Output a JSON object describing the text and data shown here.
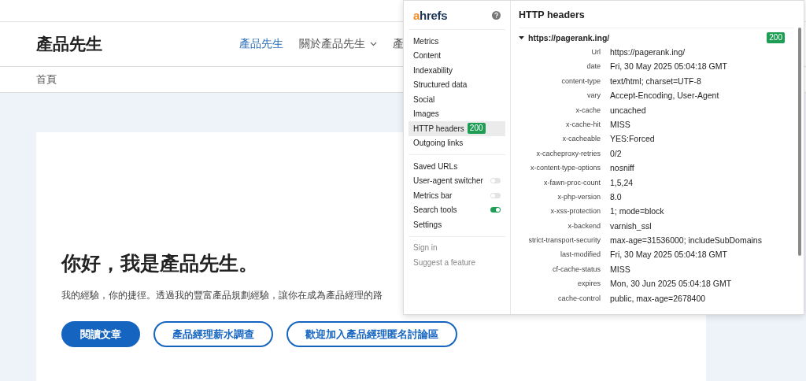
{
  "site": {
    "logo": "產品先生",
    "nav": [
      {
        "label": "產品先生",
        "selected": true
      },
      {
        "label": "關於產品先生",
        "selected": false,
        "dropdown": true
      },
      {
        "label": "產",
        "selected": false
      }
    ],
    "breadcrumb": "首頁",
    "hero": {
      "heading": "你好，我是產品先生。",
      "text": "我的經驗，你的捷徑。透過我的豐富產品規劃經驗，讓你在成為產品經理的路",
      "buttons": [
        {
          "label": "閱讀文章",
          "kind": "primary"
        },
        {
          "label": "產品經理薪水調查",
          "kind": "outline"
        },
        {
          "label": "歡迎加入產品經理匿名討論區",
          "kind": "outline"
        }
      ]
    }
  },
  "extension": {
    "logo": "ahrefs",
    "menu_sections": [
      [
        {
          "label": "Metrics",
          "kind": "link",
          "selected": false
        },
        {
          "label": "Content",
          "kind": "link",
          "selected": false
        },
        {
          "label": "Indexability",
          "kind": "link",
          "selected": false
        },
        {
          "label": "Structured data",
          "kind": "link",
          "selected": false
        },
        {
          "label": "Social",
          "kind": "link",
          "selected": false
        },
        {
          "label": "Images",
          "kind": "link",
          "selected": false
        },
        {
          "label": "HTTP headers",
          "kind": "link",
          "selected": true,
          "badge": "200"
        },
        {
          "label": "Outgoing links",
          "kind": "link",
          "selected": false
        }
      ],
      [
        {
          "label": "Saved URLs",
          "kind": "link",
          "selected": false
        },
        {
          "label": "User-agent switcher",
          "kind": "toggle",
          "selected": false,
          "on": false
        },
        {
          "label": "Metrics bar",
          "kind": "toggle",
          "selected": false,
          "on": false
        },
        {
          "label": "Search tools",
          "kind": "toggle",
          "selected": false,
          "on": true
        },
        {
          "label": "Settings",
          "kind": "link",
          "selected": false
        }
      ],
      [
        {
          "label": "Sign in",
          "kind": "muted",
          "selected": false
        },
        {
          "label": "Suggest a feature",
          "kind": "muted",
          "selected": false
        }
      ]
    ],
    "panel": {
      "title": "HTTP headers",
      "url": "https://pagerank.ing/",
      "expanded": true,
      "status": "200",
      "headers": [
        {
          "name": "Url",
          "value": "https://pagerank.ing/"
        },
        {
          "name": "date",
          "value": "Fri, 30 May 2025 05:04:18 GMT"
        },
        {
          "name": "content-type",
          "value": "text/html; charset=UTF-8"
        },
        {
          "name": "vary",
          "value": "Accept-Encoding, User-Agent"
        },
        {
          "name": "x-cache",
          "value": "uncached"
        },
        {
          "name": "x-cache-hit",
          "value": "MISS"
        },
        {
          "name": "x-cacheable",
          "value": "YES:Forced"
        },
        {
          "name": "x-cacheproxy-retries",
          "value": "0/2"
        },
        {
          "name": "x-content-type-options",
          "value": "nosniff"
        },
        {
          "name": "x-fawn-proc-count",
          "value": "1,5,24"
        },
        {
          "name": "x-php-version",
          "value": "8.0"
        },
        {
          "name": "x-xss-protection",
          "value": "1; mode=block"
        },
        {
          "name": "x-backend",
          "value": "varnish_ssl"
        },
        {
          "name": "strict-transport-security",
          "value": "max-age=31536000; includeSubDomains"
        },
        {
          "name": "last-modified",
          "value": "Fri, 30 May 2025 05:04:18 GMT"
        },
        {
          "name": "cf-cache-status",
          "value": "MISS"
        },
        {
          "name": "expires",
          "value": "Mon, 30 Jun 2025 05:04:18 GMT"
        },
        {
          "name": "cache-control",
          "value": "public, max-age=2678400"
        }
      ]
    }
  }
}
